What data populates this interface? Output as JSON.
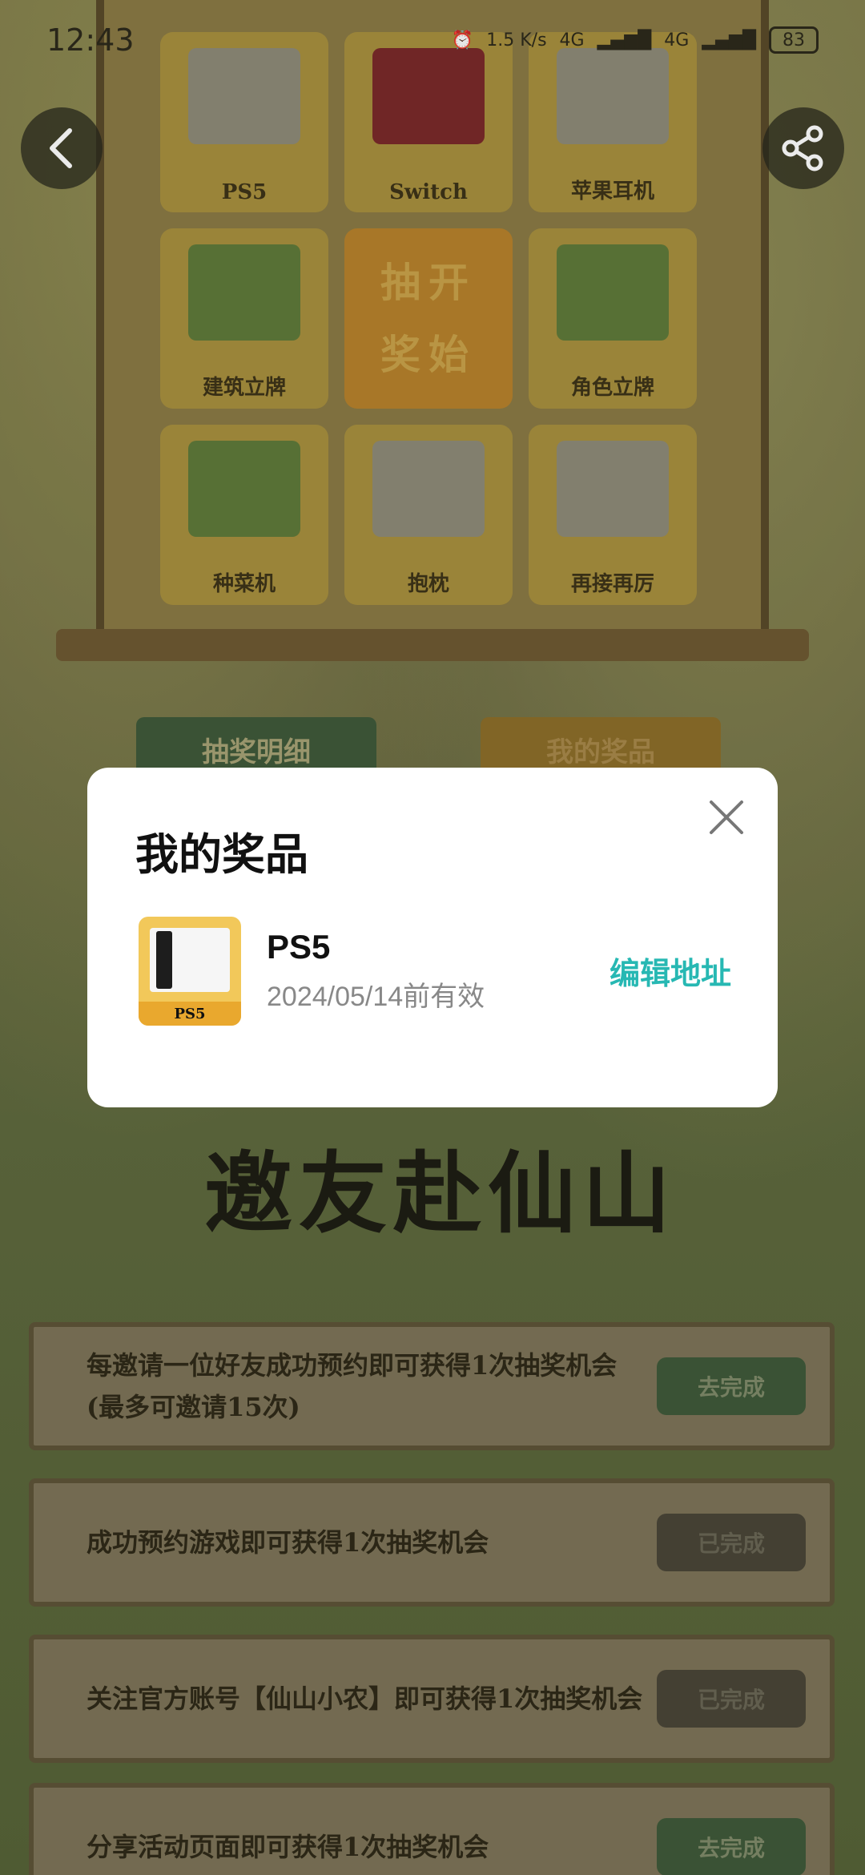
{
  "status_bar": {
    "time": "12:43",
    "net_speed": "1.5 K/s",
    "signal1": "4G",
    "signal2": "4G",
    "battery": "83"
  },
  "prizes": [
    {
      "label": "PS5",
      "icon": "ps5-console"
    },
    {
      "label": "Switch",
      "icon": "switch-console"
    },
    {
      "label": "苹果耳机",
      "icon": "earbuds"
    },
    {
      "label": "建筑立牌",
      "icon": "building-stand"
    },
    {
      "label": "抽开奖始",
      "icon": "start-draw"
    },
    {
      "label": "角色立牌",
      "icon": "character-stand"
    },
    {
      "label": "种菜机",
      "icon": "planter"
    },
    {
      "label": "抱枕",
      "icon": "pillow"
    },
    {
      "label": "再接再厉",
      "icon": "try-again"
    }
  ],
  "start": {
    "line1": "抽开",
    "line2": "奖始"
  },
  "tabs": {
    "left": "抽奖明细",
    "right": "我的奖品"
  },
  "banner": {
    "title": "邀友赴仙山"
  },
  "tasks": [
    {
      "text": "每邀请一位好友成功预约即可获得1次抽奖机会(最多可邀请15次)",
      "button": "去完成",
      "state": "go"
    },
    {
      "text": "成功预约游戏即可获得1次抽奖机会",
      "button": "已完成",
      "state": "done"
    },
    {
      "text": "关注官方账号【仙山小农】即可获得1次抽奖机会",
      "button": "已完成",
      "state": "done"
    },
    {
      "text": "分享活动页面即可获得1次抽奖机会",
      "button": "去完成",
      "state": "go"
    }
  ],
  "modal": {
    "title": "我的奖品",
    "prize_name": "PS5",
    "prize_thumb_label": "PS5",
    "valid_until": "2024/05/14前有效",
    "action": "编辑地址"
  },
  "colors": {
    "accent": "#27b8b3"
  }
}
